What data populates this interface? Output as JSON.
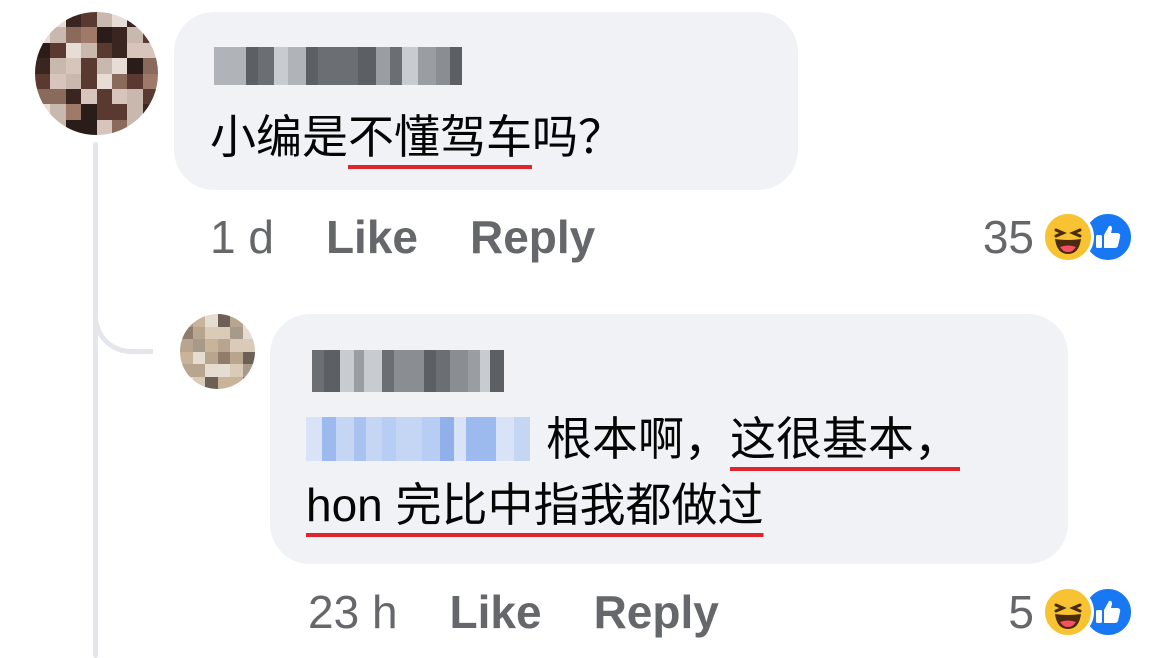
{
  "comments": [
    {
      "author_obscured": true,
      "text_parts": [
        {
          "text": "小编是",
          "underline": false
        },
        {
          "text": "不懂驾车",
          "underline": true
        },
        {
          "text": "吗？",
          "underline": false
        }
      ],
      "time": "1 d",
      "like_label": "Like",
      "reply_label": "Reply",
      "reaction_count": "35",
      "reactions": [
        "haha-icon",
        "like-icon"
      ]
    },
    {
      "author_obscured": true,
      "mention_obscured": true,
      "text_parts": [
        {
          "text": "根本啊，",
          "underline": false
        },
        {
          "text": "这很基本，hon 完比中指我都做过",
          "underline": true
        }
      ],
      "time": "23 h",
      "like_label": "Like",
      "reply_label": "Reply",
      "reaction_count": "5",
      "reactions": [
        "haha-icon",
        "like-icon"
      ]
    }
  ],
  "colors": {
    "bubble": "#f0f2f5",
    "meta_text": "#65676b",
    "underline": "#e0242c",
    "like_blue": "#1877f2",
    "haha_yellow": "#f7c332"
  }
}
